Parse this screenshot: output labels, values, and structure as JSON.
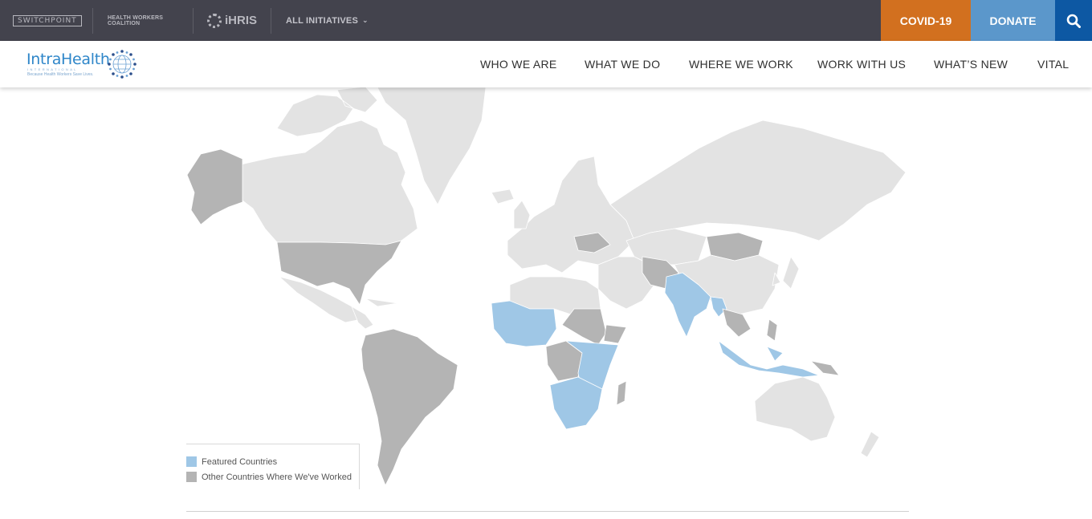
{
  "topbar": {
    "initiatives": [
      {
        "label": "SWITCHPOINT"
      },
      {
        "label": "HEALTH WORKERS COALITION"
      },
      {
        "label": "iHRIS"
      }
    ],
    "all_initiatives_label": "ALL INITIATIVES",
    "covid_label": "COVID-19",
    "donate_label": "DONATE",
    "search_icon": "search-icon",
    "colors": {
      "bar": "#43434d",
      "covid": "#d2701f",
      "donate": "#5b97cb",
      "search": "#0d58a3"
    }
  },
  "brand": {
    "name": "IntraHealth",
    "sub": "INTERNATIONAL",
    "tagline": "Because Health Workers Save Lives."
  },
  "nav": {
    "items": [
      {
        "label": "WHO WE ARE"
      },
      {
        "label": "WHAT WE DO"
      },
      {
        "label": "WHERE WE WORK"
      },
      {
        "label": "WORK WITH US"
      },
      {
        "label": "WHAT’S NEW"
      },
      {
        "label": "VITAL"
      }
    ]
  },
  "map": {
    "colors": {
      "featured": "#9fc7e6",
      "worked": "#b4b4b4",
      "other": "#e3e3e3"
    },
    "legend": {
      "featured_label": "Featured Countries",
      "worked_label": "Other Countries Where We've Worked"
    }
  }
}
